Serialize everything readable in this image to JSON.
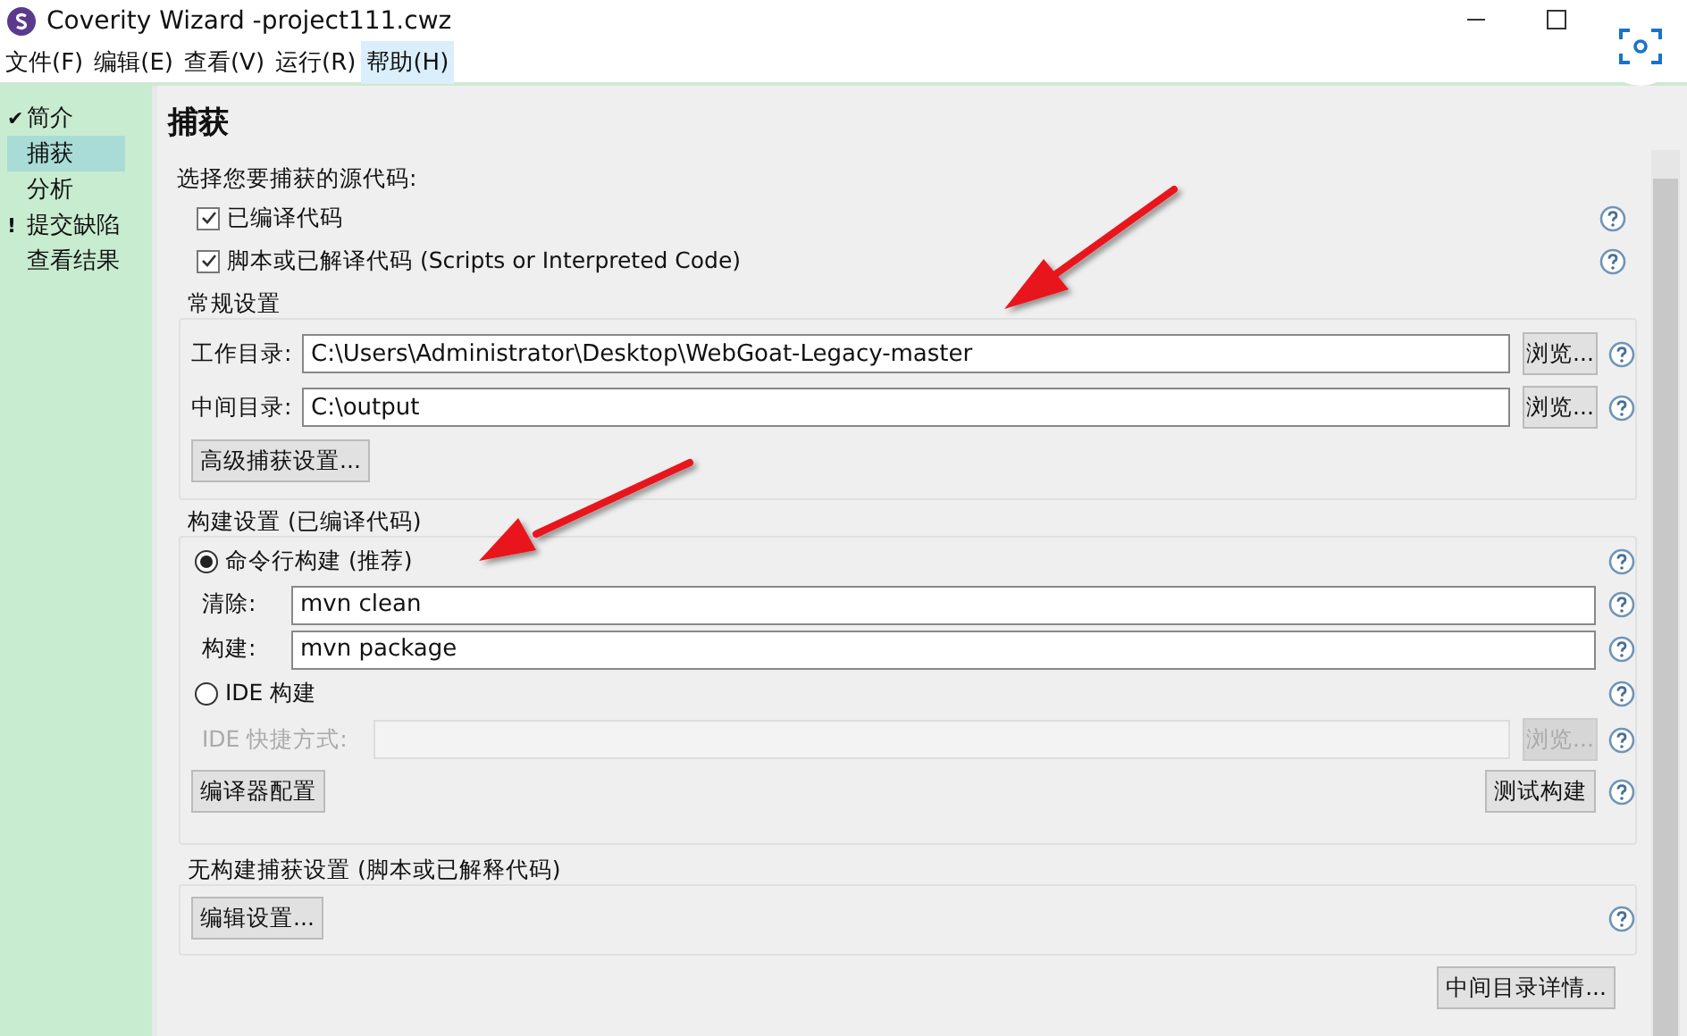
{
  "window": {
    "title": "Coverity Wizard -project111.cwz"
  },
  "menu": [
    {
      "label": "文件(F)",
      "selected": false
    },
    {
      "label": "编辑(E)",
      "selected": false
    },
    {
      "label": "查看(V)",
      "selected": false
    },
    {
      "label": "运行(R)",
      "selected": false
    },
    {
      "label": "帮助(H)",
      "selected": true
    }
  ],
  "sidebar": {
    "items": [
      {
        "mark": "✔",
        "label": "简介",
        "selected": false
      },
      {
        "label": "捕获",
        "selected": true
      },
      {
        "label": "分析",
        "selected": false
      },
      {
        "mark": "!",
        "label": "提交缺陷",
        "selected": false
      },
      {
        "label": "查看结果",
        "selected": false
      }
    ]
  },
  "page": {
    "heading": "捕获",
    "source_prompt": "选择您要捕获的源代码:",
    "source_options": [
      {
        "label": "已编译代码",
        "checked": true
      },
      {
        "label": "脚本或已解译代码 (Scripts or Interpreted Code)",
        "checked": true
      }
    ]
  },
  "general": {
    "title": "常规设置",
    "fields": [
      {
        "label": "工作目录:",
        "value": "C:\\Users\\Administrator\\Desktop\\WebGoat-Legacy-master",
        "button": "浏览..."
      },
      {
        "label": "中间目录:",
        "value": "C:\\output",
        "button": "浏览..."
      }
    ],
    "advanced_button": "高级捕获设置..."
  },
  "build": {
    "title": "构建设置 (已编译代码)",
    "command_line": {
      "label": "命令行构建 (推荐)",
      "selected": true
    },
    "commands": [
      {
        "label": "清除:",
        "value": "mvn clean"
      },
      {
        "label": "构建:",
        "value": "mvn package"
      }
    ],
    "ide": {
      "label": "IDE 构建",
      "selected": false
    },
    "ide_shortcut": {
      "label": "IDE 快捷方式:",
      "button": "浏览...",
      "disabled": true
    },
    "compiler_button": "编译器配置",
    "test_button": "测试构建"
  },
  "no_build": {
    "title": "无构建捕获设置 (脚本或已解释代码)",
    "edit_button": "编辑设置..."
  },
  "details_button": "中间目录详情..."
}
